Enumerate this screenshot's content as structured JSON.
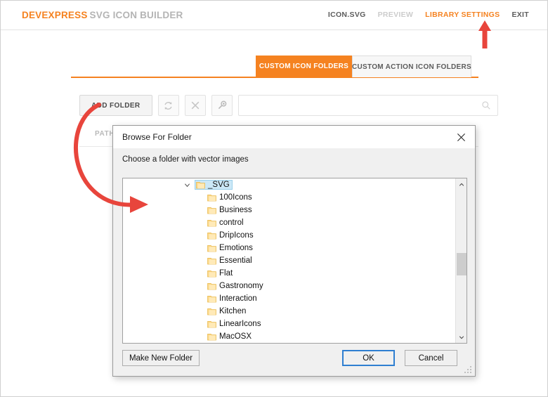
{
  "header": {
    "brand_primary": "DEVEXPRESS",
    "brand_secondary": "SVG ICON BUILDER",
    "nav": [
      {
        "label": "ICON.SVG",
        "state": "normal"
      },
      {
        "label": "PREVIEW",
        "state": "dim"
      },
      {
        "label": "LIBRARY SETTINGS",
        "state": "active"
      },
      {
        "label": "EXIT",
        "state": "normal"
      }
    ]
  },
  "tabs": [
    {
      "label": "CUSTOM ICON FOLDERS",
      "active": true
    },
    {
      "label": "CUSTOM ACTION ICON FOLDERS",
      "active": false
    }
  ],
  "toolbar": {
    "add_folder_label": "ADD FOLDER",
    "refresh_icon": "refresh-icon",
    "delete_icon": "close-x-icon",
    "pin_icon": "pin-icon",
    "search_placeholder": "",
    "search_value": "",
    "search_icon": "search-icon"
  },
  "grid": {
    "column_header": "PATH"
  },
  "dialog": {
    "title": "Browse For Folder",
    "close_icon": "close-icon",
    "prompt": "Choose a folder with vector images",
    "tree": {
      "root": {
        "label": "_SVG",
        "expanded": true,
        "selected": true,
        "expander_icon": "chevron-down-icon"
      },
      "children": [
        {
          "label": "100Icons"
        },
        {
          "label": "Business"
        },
        {
          "label": "control"
        },
        {
          "label": "DripIcons"
        },
        {
          "label": "Emotions"
        },
        {
          "label": "Essential"
        },
        {
          "label": "Flat"
        },
        {
          "label": "Gastronomy"
        },
        {
          "label": "Interaction"
        },
        {
          "label": "Kitchen"
        },
        {
          "label": "LinearIcons"
        },
        {
          "label": "MacOSX"
        }
      ]
    },
    "scrollbar": {
      "up_icon": "chevron-up-icon",
      "down_icon": "chevron-down-icon"
    },
    "buttons": {
      "new_folder": "Make New Folder",
      "ok": "OK",
      "cancel": "Cancel"
    }
  },
  "annotations": {
    "up_arrow": "red-up-arrow",
    "curved_arrow": "red-curved-arrow"
  },
  "colors": {
    "brand_orange": "#f58220",
    "annotation_red": "#e8453c",
    "selection_blue": "#cce8f7",
    "folder_yellow": "#ffd966"
  }
}
